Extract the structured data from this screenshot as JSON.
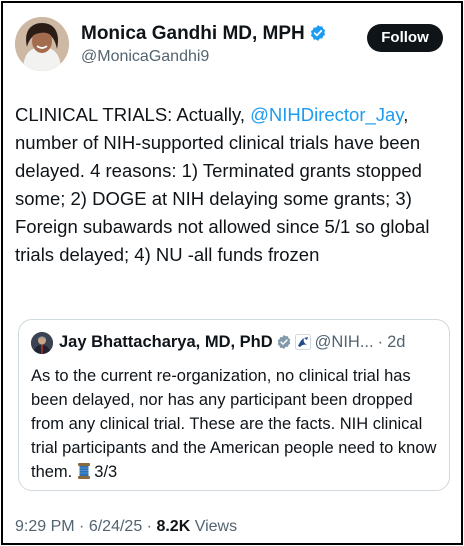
{
  "author": {
    "name": "Monica Gandhi MD, MPH",
    "handle": "@MonicaGandhi9",
    "follow_label": "Follow"
  },
  "tweet": {
    "text_before_mention": "CLINICAL TRIALS: Actually, ",
    "mention": "@NIHDirector_Jay",
    "text_after_mention": ", number of NIH-supported clinical trials have been delayed. 4 reasons: 1) Terminated grants stopped some; 2) DOGE at NIH delaying some grants; 3) Foreign subawards not allowed since 5/1 so global trials delayed; 4) NU -all funds frozen"
  },
  "quote": {
    "name": "Jay Bhattacharya, MD, PhD",
    "handle": "@NIH...",
    "separator": "·",
    "age": "2d",
    "text": "As to the current re-organization, no clinical trial has been delayed, nor has any participant been dropped from any clinical trial. These are the facts. NIH clinical trial participants and the American people need to know them.",
    "thread_label": "3/3"
  },
  "meta": {
    "time": "9:29 PM",
    "separator": "·",
    "date": "6/24/25",
    "views_count": "8.2K",
    "views_label": "Views"
  },
  "colors": {
    "accent": "#1d9bf0",
    "text": "#0f1419",
    "muted": "#536471",
    "follow_bg": "#0f1419",
    "border": "#cfd9de"
  },
  "icons": {
    "verified": "verified-badge-icon",
    "gray_verified": "gray-verified-badge-icon",
    "affiliation": "hhs-affiliation-icon",
    "thread": "spool-of-thread-icon"
  }
}
